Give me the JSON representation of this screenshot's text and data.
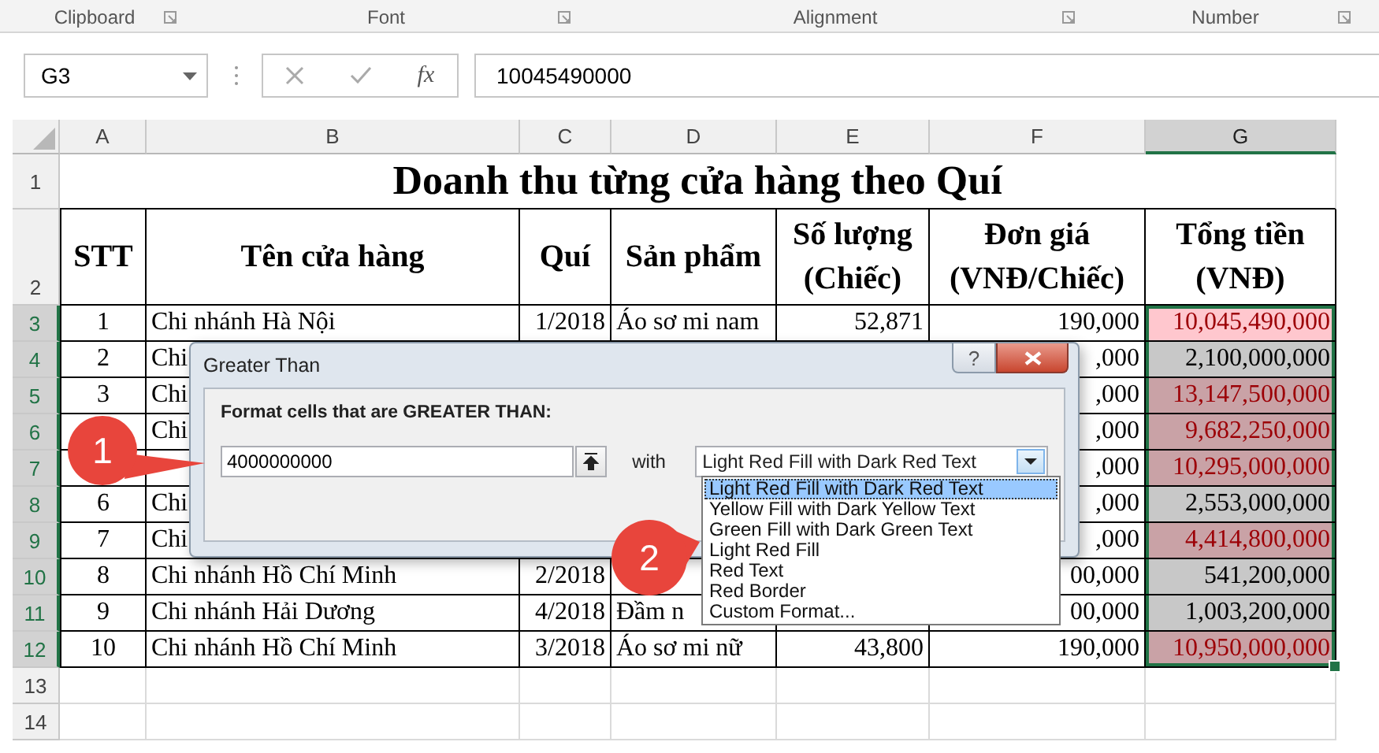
{
  "ribbon_groups": [
    {
      "label": "Clipboard"
    },
    {
      "label": "Font"
    },
    {
      "label": "Alignment"
    },
    {
      "label": "Number"
    }
  ],
  "formula_bar": {
    "name_box": "G3",
    "fx": "fx",
    "value": "10045490000"
  },
  "columns": [
    {
      "label": "A",
      "selected": false
    },
    {
      "label": "B",
      "selected": false
    },
    {
      "label": "C",
      "selected": false
    },
    {
      "label": "D",
      "selected": false
    },
    {
      "label": "E",
      "selected": false
    },
    {
      "label": "F",
      "selected": false
    },
    {
      "label": "G",
      "selected": true
    }
  ],
  "sheet": {
    "title_row": "1",
    "title": "Doanh thu từng cửa hàng theo Quí",
    "header_row": "2",
    "headers": [
      "STT",
      "Tên cửa hàng",
      "Quí",
      "Sản phẩm",
      "Số lượng\n(Chiếc)",
      "Đơn giá\n(VNĐ/Chiếc)",
      "Tổng tiền\n(VNĐ)"
    ],
    "rows": [
      {
        "row": "3",
        "selected": true,
        "cells": [
          "1",
          "Chi nhánh Hà Nội",
          "1/2018",
          "Áo sơ mi nam",
          "52,871",
          "190,000"
        ],
        "total": {
          "text": "10,045,490,000",
          "highlighted": true,
          "active": true
        }
      },
      {
        "row": "4",
        "selected": true,
        "cells": [
          "2",
          "Chi",
          "",
          "",
          "",
          ",000"
        ],
        "total": {
          "text": "2,100,000,000",
          "highlighted": false,
          "active": false
        }
      },
      {
        "row": "5",
        "selected": true,
        "cells": [
          "3",
          "Chi",
          "",
          "",
          "",
          ",000"
        ],
        "total": {
          "text": "13,147,500,000",
          "highlighted": true,
          "active": false
        }
      },
      {
        "row": "6",
        "selected": true,
        "cells": [
          "",
          "Chi",
          "",
          "",
          "",
          ",000"
        ],
        "total": {
          "text": "9,682,250,000",
          "highlighted": true,
          "active": false
        }
      },
      {
        "row": "7",
        "selected": true,
        "cells": [
          "",
          "",
          "",
          "",
          "",
          ",000"
        ],
        "total": {
          "text": "10,295,000,000",
          "highlighted": true,
          "active": false
        }
      },
      {
        "row": "8",
        "selected": true,
        "cells": [
          "6",
          "Chi",
          "",
          "",
          "",
          ",000"
        ],
        "total": {
          "text": "2,553,000,000",
          "highlighted": false,
          "active": false
        }
      },
      {
        "row": "9",
        "selected": true,
        "cells": [
          "7",
          "Chi",
          "",
          "",
          "",
          ",000"
        ],
        "total": {
          "text": "4,414,800,000",
          "highlighted": true,
          "active": false
        }
      },
      {
        "row": "10",
        "selected": true,
        "cells": [
          "8",
          "Chi nhánh Hồ Chí Minh",
          "2/2018",
          "",
          "",
          "00,000"
        ],
        "total": {
          "text": "541,200,000",
          "highlighted": false,
          "active": false
        }
      },
      {
        "row": "11",
        "selected": true,
        "cells": [
          "9",
          "Chi nhánh Hải Dương",
          "4/2018",
          "Đầm n",
          "",
          "00,000"
        ],
        "total": {
          "text": "1,003,200,000",
          "highlighted": false,
          "active": false
        }
      },
      {
        "row": "12",
        "selected": true,
        "cells": [
          "10",
          "Chi nhánh Hồ Chí Minh",
          "3/2018",
          "Áo sơ mi nữ",
          "43,800",
          "190,000"
        ],
        "total": {
          "text": "10,950,000,000",
          "highlighted": true,
          "active": false
        }
      }
    ],
    "empty_rows": [
      "13",
      "14"
    ]
  },
  "dialog": {
    "title": "Greater Than",
    "help": "?",
    "prompt": "Format cells that are GREATER THAN:",
    "value": "4000000000",
    "with": "with",
    "format": "Light Red Fill with Dark Red Text"
  },
  "dropdown": {
    "items": [
      {
        "label": "Light Red Fill with Dark Red Text",
        "selected": true
      },
      {
        "label": "Yellow Fill with Dark Yellow Text",
        "selected": false
      },
      {
        "label": "Green Fill with Dark Green Text",
        "selected": false
      },
      {
        "label": "Light Red Fill",
        "selected": false
      },
      {
        "label": "Red Text",
        "selected": false
      },
      {
        "label": "Red Border",
        "selected": false
      },
      {
        "label": "Custom Format...",
        "selected": false
      }
    ]
  },
  "callouts": [
    {
      "label": "1"
    },
    {
      "label": "2"
    }
  ]
}
